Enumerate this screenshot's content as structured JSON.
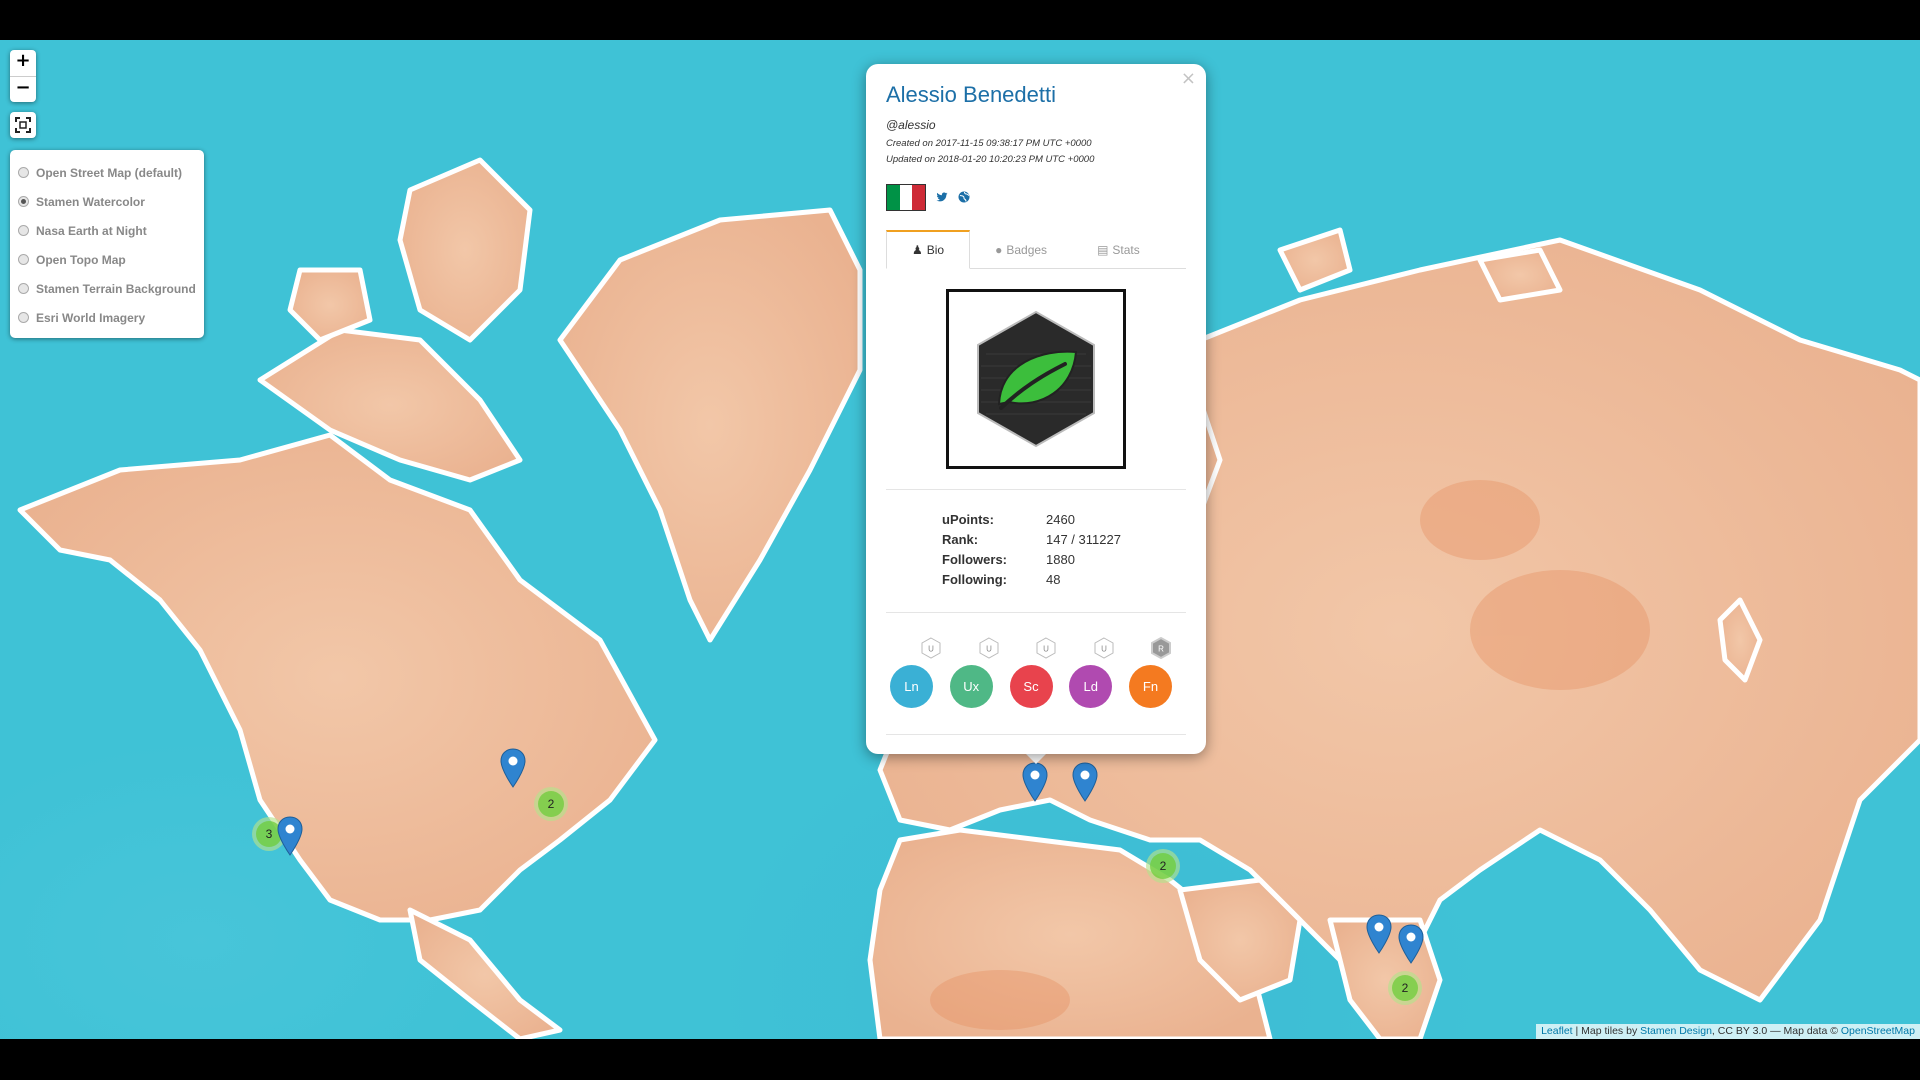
{
  "map": {
    "zoom_in": "+",
    "zoom_out": "−",
    "layers": [
      {
        "label": "Open Street Map (default)",
        "checked": false
      },
      {
        "label": "Stamen Watercolor",
        "checked": true
      },
      {
        "label": "Nasa Earth at Night",
        "checked": false
      },
      {
        "label": "Open Topo Map",
        "checked": false
      },
      {
        "label": "Stamen Terrain Background",
        "checked": false
      },
      {
        "label": "Esri World Imagery",
        "checked": false
      }
    ],
    "clusters": [
      {
        "count": "3"
      },
      {
        "count": "2"
      },
      {
        "count": "2"
      },
      {
        "count": "2"
      }
    ],
    "attribution": {
      "leaflet": "Leaflet",
      "tiles_prefix": "Map tiles by ",
      "stamen": "Stamen Design",
      "tiles_suffix": ", CC BY 3.0 — Map data © ",
      "osm": "OpenStreetMap"
    }
  },
  "popup": {
    "close": "×",
    "name": "Alessio Benedetti",
    "handle": "@alessio",
    "created": "Created on 2017-11-15 09:38:17 PM UTC +0000",
    "updated": "Updated on 2018-01-20 10:20:23 PM UTC +0000",
    "tabs": [
      {
        "label": "Bio",
        "active": true
      },
      {
        "label": "Badges",
        "active": false
      },
      {
        "label": "Stats",
        "active": false
      }
    ],
    "stats": [
      {
        "key": "uPoints:",
        "value": "2460"
      },
      {
        "key": "Rank:",
        "value": "147 / 311227"
      },
      {
        "key": "Followers:",
        "value": "1880"
      },
      {
        "key": "Following:",
        "value": "48"
      }
    ],
    "hex_badges": [
      "U",
      "U",
      "U",
      "U",
      "R"
    ],
    "circle_badges": [
      {
        "label": "Ln",
        "color": "#3ab0d5"
      },
      {
        "label": "Ux",
        "color": "#4fb886"
      },
      {
        "label": "Sc",
        "color": "#e8434d"
      },
      {
        "label": "Ld",
        "color": "#b04ab0"
      },
      {
        "label": "Fn",
        "color": "#f47a20"
      }
    ],
    "flag_colors": [
      "#009246",
      "#ffffff",
      "#ce2b37"
    ],
    "accent": "#1c6fa7"
  }
}
